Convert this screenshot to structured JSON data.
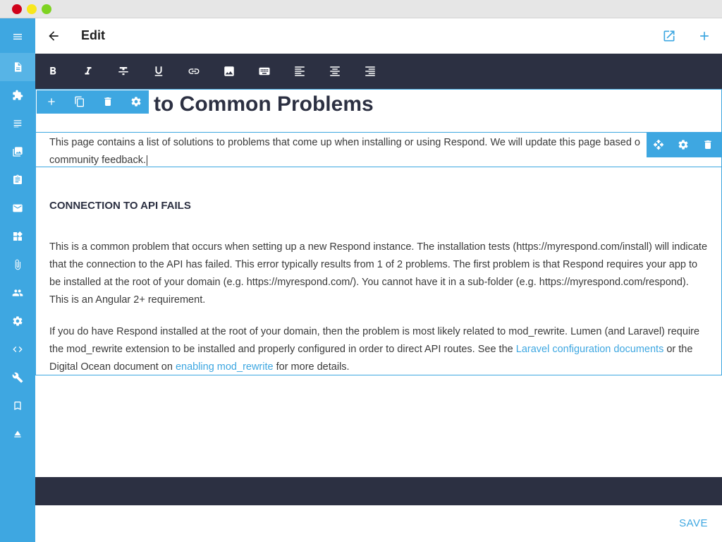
{
  "window": {
    "controls": [
      "close",
      "minimize",
      "maximize"
    ]
  },
  "sidebar": {
    "items": [
      {
        "icon": "menu-icon"
      },
      {
        "icon": "page-icon",
        "active": true
      },
      {
        "icon": "plugin-icon"
      },
      {
        "icon": "list-icon"
      },
      {
        "icon": "image-icon"
      },
      {
        "icon": "clipboard-icon"
      },
      {
        "icon": "mail-icon"
      },
      {
        "icon": "widgets-icon"
      },
      {
        "icon": "attachment-icon"
      },
      {
        "icon": "users-icon"
      },
      {
        "icon": "settings-icon"
      },
      {
        "icon": "code-icon"
      },
      {
        "icon": "wrench-icon"
      },
      {
        "icon": "bookmark-icon"
      },
      {
        "icon": "eject-icon"
      }
    ]
  },
  "topbar": {
    "title": "Edit",
    "back_icon": "arrow-back-icon",
    "open_icon": "open-in-new-icon",
    "add_icon": "plus-icon"
  },
  "toolbar": {
    "tools": [
      "bold-icon",
      "italic-icon",
      "strikethrough-icon",
      "underline-icon",
      "link-icon",
      "image-icon",
      "keyboard-icon",
      "align-left-icon",
      "align-center-icon",
      "align-right-icon"
    ]
  },
  "content": {
    "title": "to Common Problems",
    "intro_line1": "This page contains a list of solutions to problems that come up when installing or using Respond. We will update this page based o",
    "intro_line2": "community feedback.",
    "section_heading": "CONNECTION TO API FAILS",
    "para1": "This is a common problem that occurs when setting up a new Respond instance.  The installation tests (https://myrespond.com/install) will indicate that the connection to the API has failed.  This error typically results from 1 of 2 problems.  The first problem is that Respond requires your app to be installed at the root of your domain (e.g. https://myrespond.com/).  You cannot have it in a sub-folder (e.g. https://myrespond.com/respond).  This is an Angular 2+ requirement.",
    "para2_a": "If you do have Respond installed at the root of your domain, then the problem is most likely related to mod_rewrite.  Lumen (and Laravel) require the mod_rewrite extension to be installed and properly configured in order to direct API routes.  See the ",
    "para2_link1": "Laravel configuration documents",
    "para2_b": " or the Digital Ocean document on ",
    "para2_link2": "enabling mod_rewrite",
    "para2_c": " for more details."
  },
  "footer": {
    "save_label": "SAVE"
  },
  "colors": {
    "accent": "#3ea7e1",
    "dark": "#2c3042",
    "sidebar": "#3ea7e1"
  }
}
